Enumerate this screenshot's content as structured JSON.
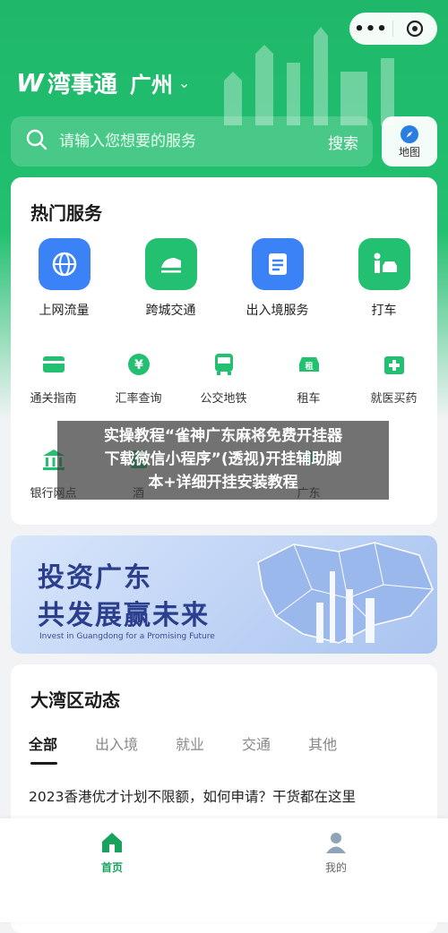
{
  "capsule": {
    "menu_icon": "more-dots-icon",
    "close_icon": "target-icon",
    "menu_glyph": "•••"
  },
  "brand": {
    "logo_text": "W",
    "name": "湾事通",
    "city": "广州",
    "city_chevron": "⌄"
  },
  "search": {
    "placeholder": "请输入您想要的服务",
    "button_label": "搜索"
  },
  "map": {
    "label": "地图",
    "icon": "compass-icon"
  },
  "hot_services": {
    "title": "热门服务",
    "big": [
      {
        "label": "上网流量",
        "icon": "globe-icon",
        "color": "#3b82f6"
      },
      {
        "label": "跨城交通",
        "icon": "train-icon",
        "color": "#22c070"
      },
      {
        "label": "出入境服务",
        "icon": "document-icon",
        "color": "#3b82f6"
      },
      {
        "label": "打车",
        "icon": "taxi-icon",
        "color": "#22c070"
      }
    ],
    "small_row1": [
      {
        "label": "通关指南",
        "icon": "card-icon"
      },
      {
        "label": "汇率查询",
        "icon": "yen-icon"
      },
      {
        "label": "公交地铁",
        "icon": "bus-icon"
      },
      {
        "label": "租车",
        "icon": "rent-car-icon",
        "badge": "租"
      },
      {
        "label": "就医买药",
        "icon": "medical-icon"
      }
    ],
    "small_row2": [
      {
        "label": "银行网点",
        "icon": "bank-icon"
      },
      {
        "label": "酒",
        "icon": "hotel-icon"
      },
      {
        "label": "广东",
        "icon": "location-icon"
      }
    ]
  },
  "banner": {
    "line1": "投资广东",
    "line2": "共发展赢未来",
    "sub": "Invest in Guangdong for a Promising Future"
  },
  "news": {
    "title": "大湾区动态",
    "tabs": [
      "全部",
      "出入境",
      "就业",
      "交通",
      "其他"
    ],
    "first_item": "2023香港优才计划不限额，如何申请？干货都在这里"
  },
  "tabbar": {
    "home": "首页",
    "mine": "我的"
  },
  "overlay": {
    "line1": "实操教程“雀神广东麻将免费开挂器",
    "line2": "下载微信小程序”(透视)开挂辅助脚",
    "line3": "本+详细开挂安装教程"
  },
  "colors": {
    "brand_green": "#22c070",
    "blue": "#3b82f6",
    "active_tab": "#18a35d"
  }
}
